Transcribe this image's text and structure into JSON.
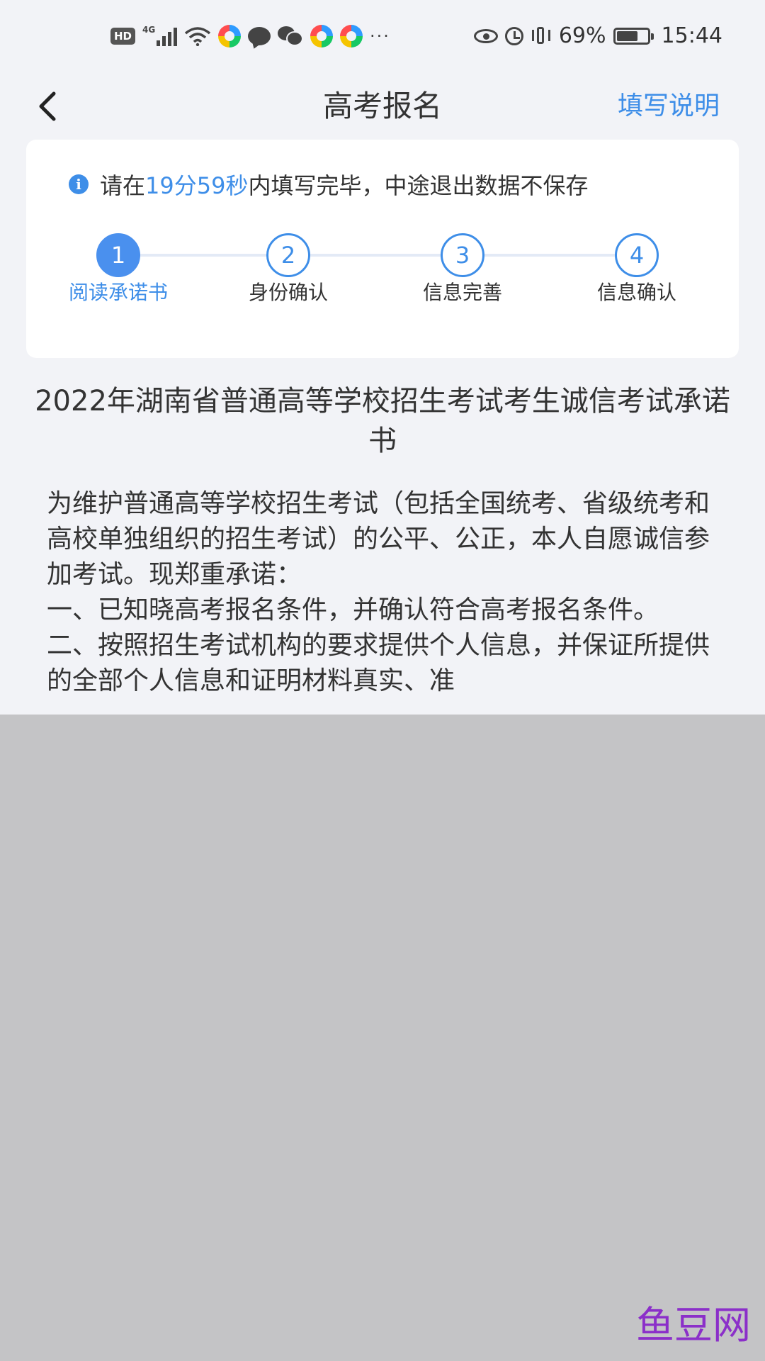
{
  "status_bar": {
    "hd": "HD",
    "network": "4G",
    "more": "···",
    "battery_percent": "69%",
    "battery_level": 0.69,
    "time": "15:44"
  },
  "nav": {
    "title": "高考报名",
    "help": "填写说明"
  },
  "card": {
    "timer_prefix": "请在",
    "timer_value": "19分59秒",
    "timer_suffix": "内填写完毕，中途退出数据不保存",
    "steps": [
      {
        "num": "1",
        "label": "阅读承诺书",
        "active": true
      },
      {
        "num": "2",
        "label": "身份确认",
        "active": false
      },
      {
        "num": "3",
        "label": "信息完善",
        "active": false
      },
      {
        "num": "4",
        "label": "信息确认",
        "active": false
      }
    ]
  },
  "document": {
    "title": "2022年湖南省普通高等学校招生考试考生诚信考试承诺书",
    "paragraphs": [
      "为维护普通高等学校招生考试（包括全国统考、省级统考和高校单独组织的招生考试）的公平、公正，本人自愿诚信参加考试。现郑重承诺：",
      "一、已知晓高考报名条件，并确认符合高考报名条件。",
      "二、按照招生考试机构的要求提供个人信息，并保证所提供的全部个人信息和证明材料真实、准"
    ]
  },
  "watermark": "鱼豆网",
  "colors": {
    "accent": "#3e8ee8",
    "background": "#f2f3f7",
    "overlay": "#c4c4c6",
    "watermark": "#8b2fc9"
  }
}
